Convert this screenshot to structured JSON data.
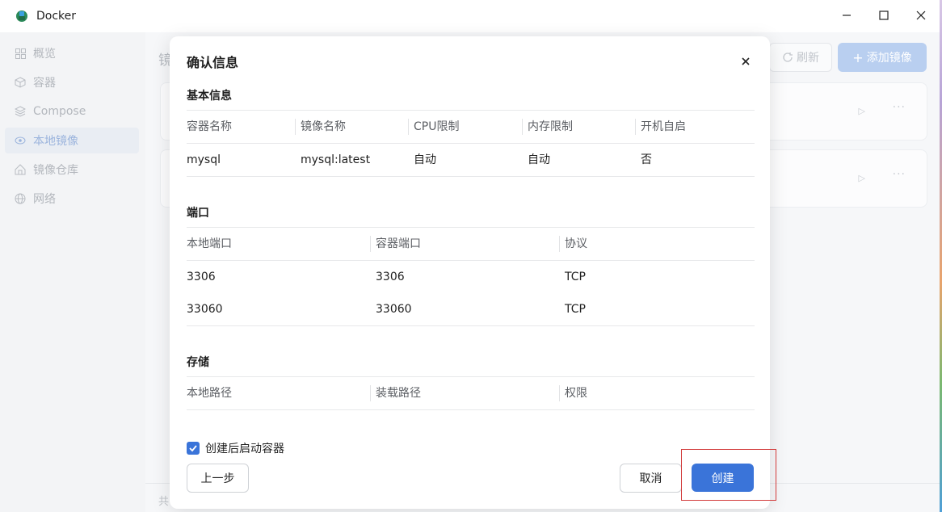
{
  "window": {
    "title": "Docker"
  },
  "sidebar": {
    "items": [
      {
        "label": "概览",
        "icon": "grid-icon"
      },
      {
        "label": "容器",
        "icon": "cube-icon"
      },
      {
        "label": "Compose",
        "icon": "layers-icon"
      },
      {
        "label": "本地镜像",
        "icon": "eye-icon",
        "active": true
      },
      {
        "label": "镜像仓库",
        "icon": "house-icon"
      },
      {
        "label": "网络",
        "icon": "globe-icon"
      }
    ]
  },
  "main": {
    "title_fragment": "镜",
    "refresh_label": "刷新",
    "add_label": "添加镜像",
    "footer_fragment": "共"
  },
  "dialog": {
    "title": "确认信息",
    "basic": {
      "title": "基本信息",
      "headers": [
        "容器名称",
        "镜像名称",
        "CPU限制",
        "内存限制",
        "开机自启"
      ],
      "row": [
        "mysql",
        "mysql:latest",
        "自动",
        "自动",
        "否"
      ]
    },
    "ports": {
      "title": "端口",
      "headers": [
        "本地端口",
        "容器端口",
        "协议"
      ],
      "rows": [
        [
          "3306",
          "3306",
          "TCP"
        ],
        [
          "33060",
          "33060",
          "TCP"
        ]
      ]
    },
    "storage": {
      "title": "存储",
      "headers": [
        "本地路径",
        "装载路径",
        "权限"
      ]
    },
    "start_after_create": {
      "label": "创建后启动容器",
      "checked": true
    },
    "buttons": {
      "prev": "上一步",
      "cancel": "取消",
      "create": "创建"
    }
  },
  "colors": {
    "accent": "#3a74d9",
    "highlight": "#d23b3b"
  }
}
